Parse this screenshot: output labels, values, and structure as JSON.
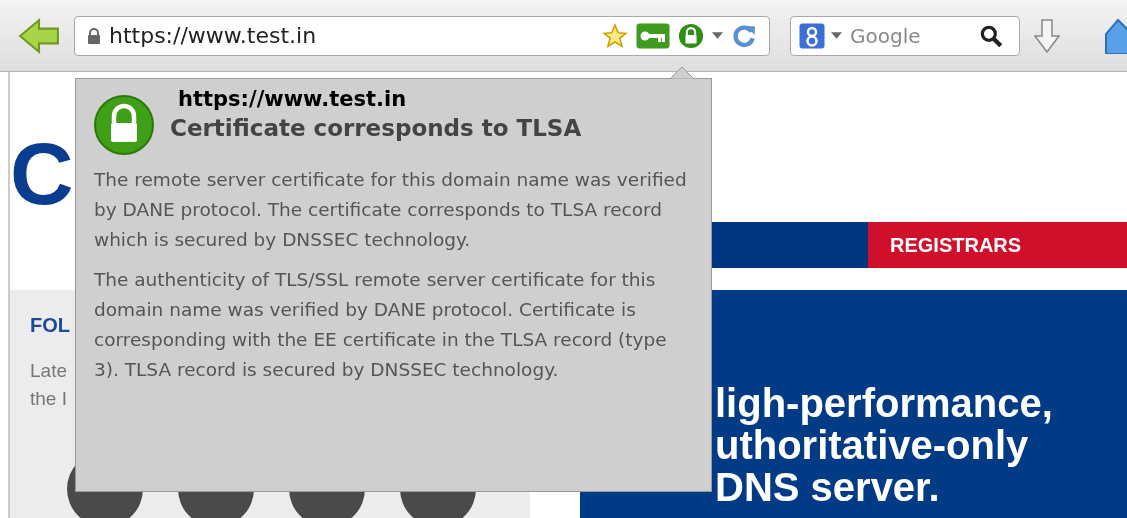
{
  "toolbar": {
    "address": {
      "value": "https://www.test.in"
    },
    "search": {
      "placeholder": "Google"
    }
  },
  "page": {
    "logo": "C",
    "nav": [
      {
        "label": "REGISTRARS",
        "color": "#d0102a"
      }
    ],
    "sidebar": {
      "heading": "FOL",
      "lines": [
        "Late",
        "the I"
      ]
    },
    "banner": {
      "lines": [
        "ligh-performance,",
        "uthoritative-only",
        "DNS server."
      ]
    }
  },
  "popup": {
    "url": "https://www.test.in",
    "title": "Certificate corresponds to TLSA",
    "paragraphs": [
      "The remote server certificate for this domain name was verified by DANE protocol. The certificate corresponds to TLSA record which is secured by DNSSEC technology.",
      "The authenticity of TLS/SSL remote server certificate for this domain name was verified by DANE protocol. Certificate is corresponding with the EE certificate in the TLSA record (type 3). TLSA record is secured by DNSSEC technology."
    ]
  }
}
